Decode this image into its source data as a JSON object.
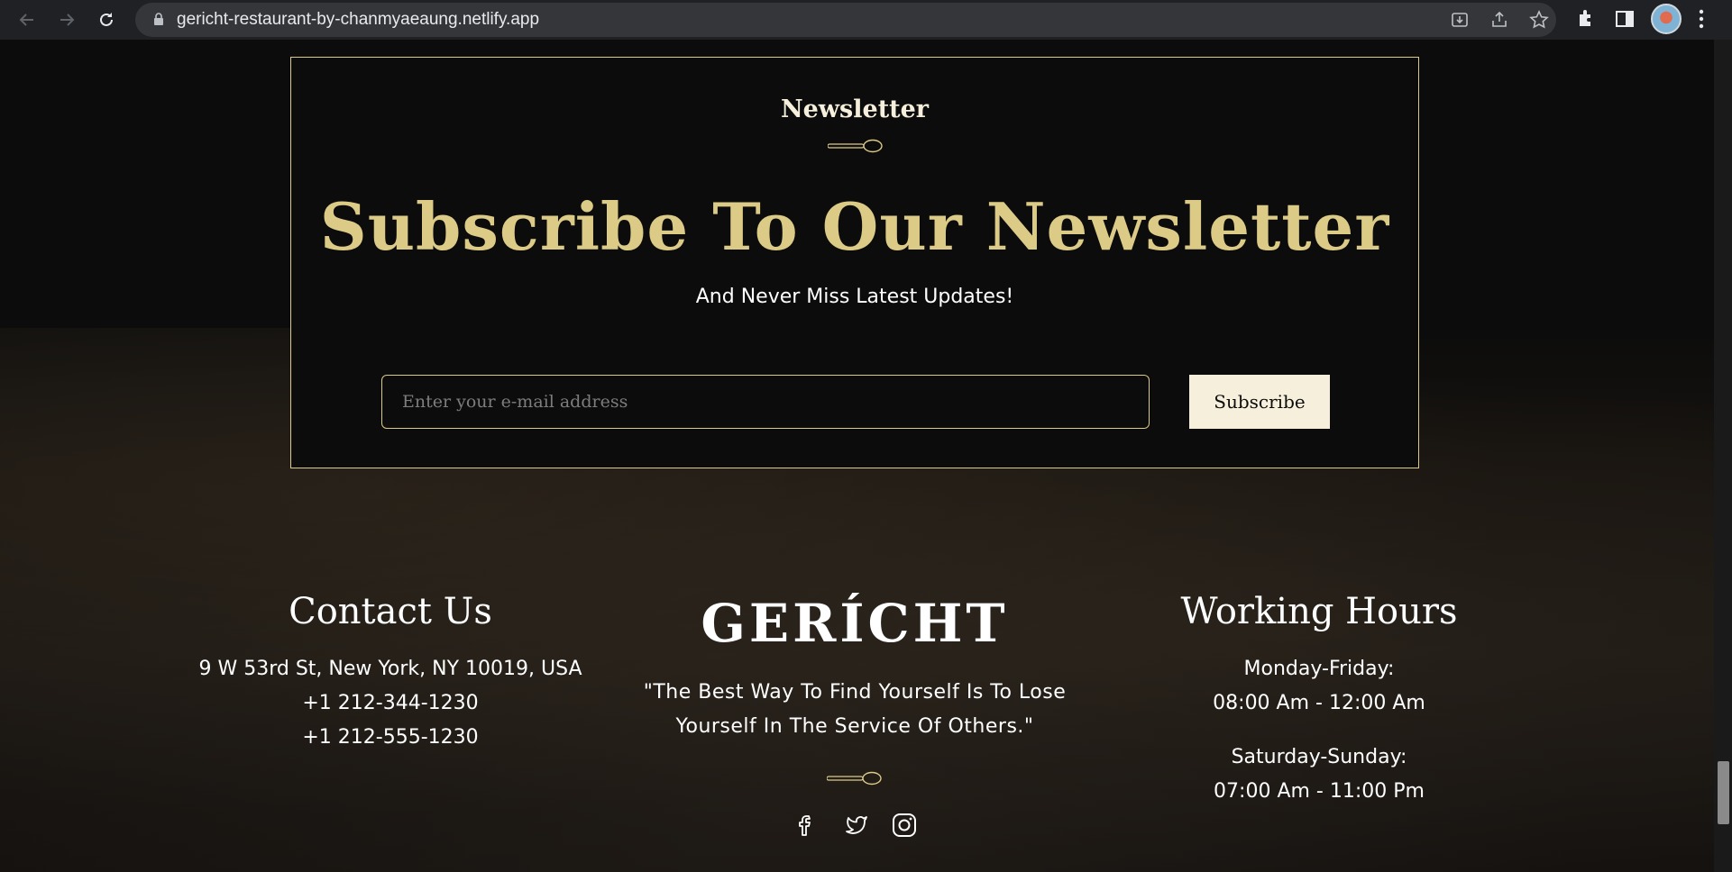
{
  "browser": {
    "url": "gericht-restaurant-by-chanmyaeaung.netlify.app"
  },
  "newsletter": {
    "subtitle": "Newsletter",
    "title": "Subscribe To Our Newsletter",
    "description": "And Never Miss Latest Updates!",
    "email_placeholder": "Enter your e-mail address",
    "button_label": "Subscribe"
  },
  "footer": {
    "contact": {
      "heading": "Contact Us",
      "address": "9 W 53rd St, New York, NY 10019, USA",
      "phone1": "+1 212-344-1230",
      "phone2": "+1 212-555-1230"
    },
    "brand": {
      "logo": "GERÍCHT",
      "quote_line1": "\"The Best Way To Find Yourself Is To Lose",
      "quote_line2": "Yourself In The Service Of Others.\"",
      "social_icons": [
        "facebook-icon",
        "twitter-icon",
        "instagram-icon"
      ]
    },
    "hours": {
      "heading": "Working Hours",
      "weekday_label": "Monday-Friday:",
      "weekday_time": "08:00 Am - 12:00 Am",
      "weekend_label": "Saturday-Sunday:",
      "weekend_time": "07:00 Am - 11:00 Pm"
    }
  },
  "colors": {
    "accent_gold": "#dcca87",
    "cream": "#f5efdb",
    "background": "#0c0c0c"
  }
}
